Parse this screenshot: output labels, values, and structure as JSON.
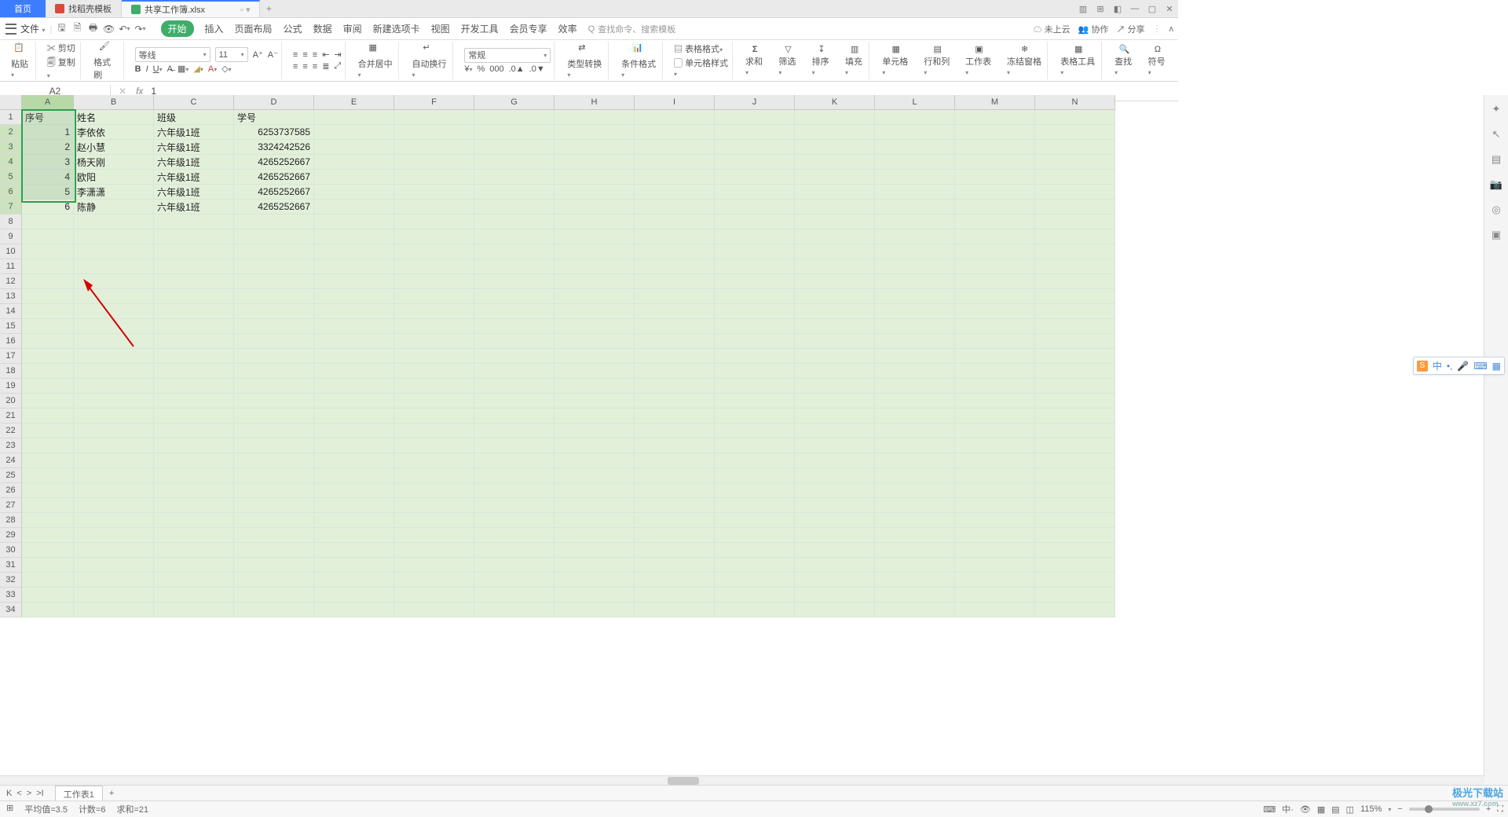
{
  "tabs": {
    "home": "首页",
    "tpl": "找稻壳模板",
    "doc": "共享工作簿.xlsx",
    "add": "+"
  },
  "win": {
    "min": "—",
    "max": "▢",
    "close": "✕"
  },
  "app": {
    "file": "文件",
    "drop": "▾"
  },
  "menutabs": {
    "start": "开始",
    "insert": "插入",
    "layout": "页面布局",
    "formula": "公式",
    "data": "数据",
    "review": "审阅",
    "newtab": "新建选项卡",
    "view": "视图",
    "dev": "开发工具",
    "member": "会员专享",
    "effect": "效率"
  },
  "search": {
    "icon": "Q",
    "ph": "查找命令、搜索模板"
  },
  "topright": {
    "cloud": "未上云",
    "coop": "协作",
    "share": "分享"
  },
  "ribbon": {
    "paste": "粘贴",
    "cut": "剪切",
    "copy": "复制",
    "format": "格式刷",
    "font": "等线",
    "size": "11",
    "merge": "合并居中",
    "wrap": "自动换行",
    "numfmt": "常规",
    "typeconv": "类型转换",
    "condfmt": "条件格式",
    "tblstyle": "表格格式",
    "cellstyle": "单元格样式",
    "sum": "求和",
    "filter": "筛选",
    "sort": "排序",
    "fill": "填充",
    "cells": "单元格",
    "rowcol": "行和列",
    "sheet": "工作表",
    "freeze": "冻结窗格",
    "tbltool": "表格工具",
    "find": "查找",
    "symbol": "符号"
  },
  "namebox": {
    "cell": "A2",
    "fx": "fx",
    "val": "1"
  },
  "columns": [
    "A",
    "B",
    "C",
    "D",
    "E",
    "F",
    "G",
    "H",
    "I",
    "J",
    "K",
    "L",
    "M",
    "N"
  ],
  "headers": {
    "A": "序号",
    "B": "姓名",
    "C": "班级",
    "D": "学号"
  },
  "rows": [
    {
      "A": "1",
      "B": "李依依",
      "C": "六年级1班",
      "D": "6253737585"
    },
    {
      "A": "2",
      "B": "赵小慧",
      "C": "六年级1班",
      "D": "3324242526"
    },
    {
      "A": "3",
      "B": "杨天刚",
      "C": "六年级1班",
      "D": "4265252667"
    },
    {
      "A": "4",
      "B": "欧阳",
      "C": "六年级1班",
      "D": "4265252667"
    },
    {
      "A": "5",
      "B": "李潇潇",
      "C": "六年级1班",
      "D": "4265252667"
    },
    {
      "A": "6",
      "B": "陈静",
      "C": "六年级1班",
      "D": "4265252667"
    }
  ],
  "totalRows": 34,
  "sheetbar": {
    "nav": [
      "K",
      "<",
      ">",
      ">I"
    ],
    "sheet": "工作表1",
    "add": "+"
  },
  "status": {
    "avg": "平均值=3.5",
    "count": "计数=6",
    "sum": "求和=21",
    "zoom": "115%"
  },
  "ime": {
    "logo": "S",
    "cn": "中"
  },
  "watermark": {
    "name": "极光下载站",
    "url": "www.xz7.com"
  }
}
